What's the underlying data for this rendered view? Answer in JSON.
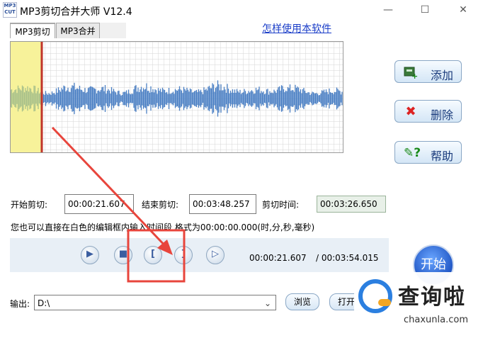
{
  "window": {
    "icon_text": "MP3 CUT",
    "title": "MP3剪切合并大师 V12.4",
    "minimize": "—",
    "maximize": "☐",
    "close": "✕"
  },
  "tabs": [
    {
      "label": "MP3剪切"
    },
    {
      "label": "MP3合并"
    }
  ],
  "help_link": "怎样使用本软件",
  "side_buttons": {
    "add": "添加",
    "delete": "删除",
    "help": "帮助"
  },
  "cut": {
    "start_label": "开始剪切:",
    "start_value": "00:00:21.607",
    "end_label": "结束剪切:",
    "end_value": "00:03:48.257",
    "duration_label": "剪切时间:",
    "duration_value": "00:03:26.650"
  },
  "hint": "您也可以直接在白色的编辑框内输入时间段,格式为00:00:00.000(时,分,秒,毫秒)",
  "player": {
    "current_time": "00:00:21.607",
    "total_time": "/ 00:03:54.015",
    "play_icon": "play-icon",
    "stop_icon": "stop-icon",
    "mark_start_text": "[",
    "mark_end_text": "]",
    "preview_icon": "play-selection-icon"
  },
  "start_button": "开始",
  "output": {
    "label": "输出:",
    "value": "D:\\",
    "browse": "浏览",
    "open": "打开"
  },
  "watermark": {
    "text": "查询啦",
    "url": "chaxunla.com"
  },
  "colors": {
    "selection_highlight": "#f7f29a",
    "cursor_line": "#c0342a",
    "wave": "#4a7fc4",
    "arrow": "#e8453c",
    "annotation_box": "#e8453c"
  },
  "waveform": {
    "selection_start_fraction": 0.092
  }
}
